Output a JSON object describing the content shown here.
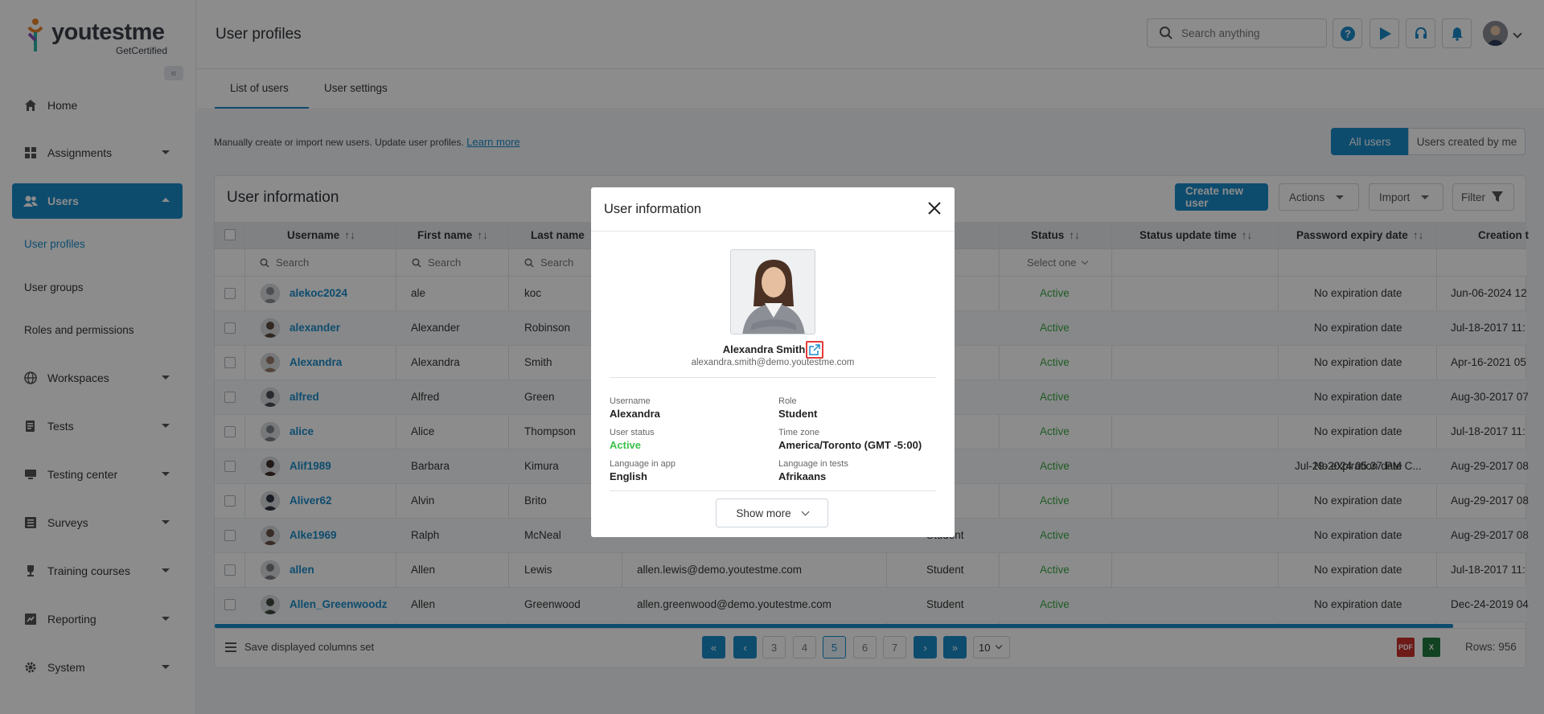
{
  "brand": {
    "name": "youtestme",
    "sub": "GetCertified"
  },
  "nav": {
    "home": "Home",
    "assignments": "Assignments",
    "users": "Users",
    "users_sub": [
      "User profiles",
      "User groups",
      "Roles and permissions"
    ],
    "workspaces": "Workspaces",
    "tests": "Tests",
    "testing_center": "Testing center",
    "surveys": "Surveys",
    "training_courses": "Training courses",
    "reporting": "Reporting",
    "system": "System"
  },
  "header": {
    "title": "User profiles",
    "search_placeholder": "Search anything"
  },
  "tabs": [
    "List of users",
    "User settings"
  ],
  "info": {
    "text": "Manually create or import new users. Update user profiles.",
    "link": "Learn more"
  },
  "toggle": {
    "all": "All users",
    "mine": "Users created by me"
  },
  "card": {
    "title": "User information",
    "create": "Create new user",
    "actions": "Actions",
    "import": "Import",
    "filter": "Filter"
  },
  "table": {
    "headers": [
      "Username",
      "First name",
      "Last name",
      "Status",
      "Status update time",
      "Password expiry date",
      "Creation t"
    ],
    "filters": {
      "search": "Search",
      "select": "Select one"
    },
    "rows": [
      {
        "username": "alekoc2024",
        "first": "ale",
        "last": "koc",
        "email": "",
        "role": "nt",
        "status": "Active",
        "status_time": "",
        "pwd": "No expiration date",
        "created": "Jun-06-2024 12"
      },
      {
        "username": "alexander",
        "first": "Alexander",
        "last": "Robinson",
        "email": "",
        "role": "nt",
        "status": "Active",
        "status_time": "",
        "pwd": "No expiration date",
        "created": "Jul-18-2017 11:"
      },
      {
        "username": "Alexandra",
        "first": "Alexandra",
        "last": "Smith",
        "email": "",
        "role": "nt",
        "status": "Active",
        "status_time": "",
        "pwd": "No expiration date",
        "created": "Apr-16-2021 05"
      },
      {
        "username": "alfred",
        "first": "Alfred",
        "last": "Green",
        "email": "",
        "role": "nt",
        "status": "Active",
        "status_time": "",
        "pwd": "No expiration date",
        "created": "Aug-30-2017 07"
      },
      {
        "username": "alice",
        "first": "Alice",
        "last": "Thompson",
        "email": "",
        "role": "nt",
        "status": "Active",
        "status_time": "",
        "pwd": "No expiration date",
        "created": "Jul-18-2017 11:"
      },
      {
        "username": "Alif1989",
        "first": "Barbara",
        "last": "Kimura",
        "email": "",
        "role": "nt",
        "status": "Active",
        "status_time": "Jul-29-2024 05:37 PM C...",
        "pwd": "No expiration date",
        "created": "Aug-29-2017 08"
      },
      {
        "username": "Aliver62",
        "first": "Alvin",
        "last": "Brito",
        "email": "",
        "role": "nt",
        "status": "Active",
        "status_time": "",
        "pwd": "No expiration date",
        "created": "Aug-29-2017 08"
      },
      {
        "username": "Alke1969",
        "first": "Ralph",
        "last": "McNeal",
        "email": "",
        "role": "Student",
        "status": "Active",
        "status_time": "",
        "pwd": "No expiration date",
        "created": "Aug-29-2017 08"
      },
      {
        "username": "allen",
        "first": "Allen",
        "last": "Lewis",
        "email": "allen.lewis@demo.youtestme.com",
        "role": "Student",
        "status": "Active",
        "status_time": "",
        "pwd": "No expiration date",
        "created": "Jul-18-2017 11:"
      },
      {
        "username": "Allen_Greenwoodz",
        "first": "Allen",
        "last": "Greenwood",
        "email": "allen.greenwood@demo.youtestme.com",
        "role": "Student",
        "status": "Active",
        "status_time": "",
        "pwd": "No expiration date",
        "created": "Dec-24-2019 04"
      }
    ]
  },
  "footer": {
    "save_cols": "Save displayed columns set",
    "pages": [
      "3",
      "4",
      "5",
      "6",
      "7"
    ],
    "current_page": "5",
    "page_size": "10",
    "rows": "Rows: 956"
  },
  "modal": {
    "title": "User information",
    "name": "Alexandra Smith",
    "email": "alexandra.smith@demo.youtestme.com",
    "fields": {
      "username_label": "Username",
      "username": "Alexandra",
      "role_label": "Role",
      "role": "Student",
      "status_label": "User status",
      "status": "Active",
      "tz_label": "Time zone",
      "tz": "America/Toronto (GMT -5:00)",
      "lang_app_label": "Language in app",
      "lang_app": "English",
      "lang_tests_label": "Language in tests",
      "lang_tests": "Afrikaans"
    },
    "show_more": "Show more"
  },
  "colors": {
    "accent": "#1a8bc9",
    "active": "#3aa844",
    "highlight": "#e53b3b"
  }
}
